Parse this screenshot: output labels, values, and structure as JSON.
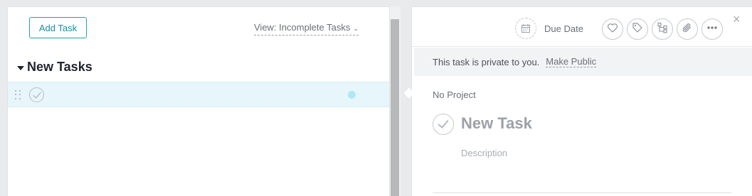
{
  "task_list": {
    "add_task_label": "Add Task",
    "view_filter_label": "View: Incomplete Tasks",
    "section": {
      "title": "New Tasks"
    },
    "rows": [
      {
        "name": "",
        "completed": false
      }
    ]
  },
  "details": {
    "due_date_label": "Due Date",
    "privacy_text": "This task is private to you.",
    "make_public_label": "Make Public",
    "project_label": "No Project",
    "task_name": "New Task",
    "description_placeholder": "Description"
  },
  "toolbar_icons": [
    "heart-icon",
    "tag-icon",
    "subtask-icon",
    "attachment-icon",
    "more-icon"
  ],
  "colors": {
    "accent": "#1b8ea1",
    "selected_row": "#e6f6fb",
    "row_dot": "#aee8f7"
  }
}
